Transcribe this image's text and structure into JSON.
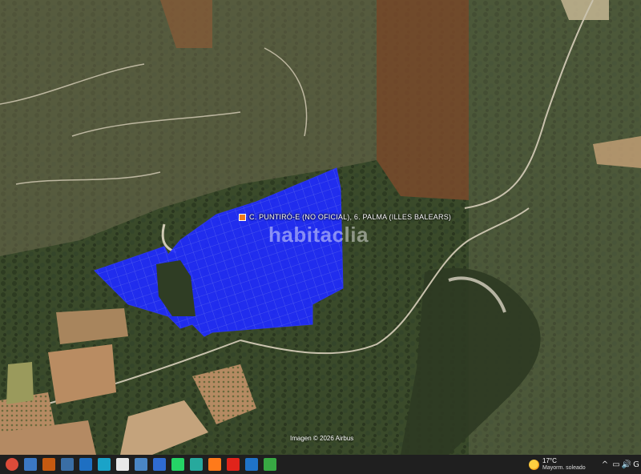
{
  "map": {
    "place_label": "C. PUNTIRÓ-E (NO OFICIAL), 6. PALMA (ILLES BALEARS)",
    "watermark": "habitaclia",
    "attribution": "Imagen © 2026 Airbus",
    "parcel_color": "#1f2bff",
    "marker_color": "#f07a1c"
  },
  "taskbar": {
    "apps": [
      {
        "name": "chrome-icon",
        "color": "#dd4b39"
      },
      {
        "name": "desktop-icon",
        "color": "#3b78c4"
      },
      {
        "name": "presentation-icon",
        "color": "#c55a11"
      },
      {
        "name": "windows-explorer-icon",
        "color": "#3a6ea5"
      },
      {
        "name": "photos-icon",
        "color": "#1e6fc2"
      },
      {
        "name": "edge-icon",
        "color": "#1aa3c8"
      },
      {
        "name": "document-icon",
        "color": "#e8e8e8"
      },
      {
        "name": "globe-icon",
        "color": "#4a86c5"
      },
      {
        "name": "save-icon",
        "color": "#2f6bd1"
      },
      {
        "name": "whatsapp-icon",
        "color": "#25d366"
      },
      {
        "name": "browser-icon",
        "color": "#27a99d"
      },
      {
        "name": "firefox-icon",
        "color": "#ff7a1a"
      },
      {
        "name": "acrobat-icon",
        "color": "#e0241b"
      },
      {
        "name": "app-s-icon",
        "color": "#1f73c8"
      },
      {
        "name": "app-green-icon",
        "color": "#38a843"
      }
    ],
    "weather": {
      "temp": "17°C",
      "desc": "Mayorm. soleado"
    },
    "tray": [
      "^",
      "▭",
      "🔊",
      "G"
    ]
  }
}
